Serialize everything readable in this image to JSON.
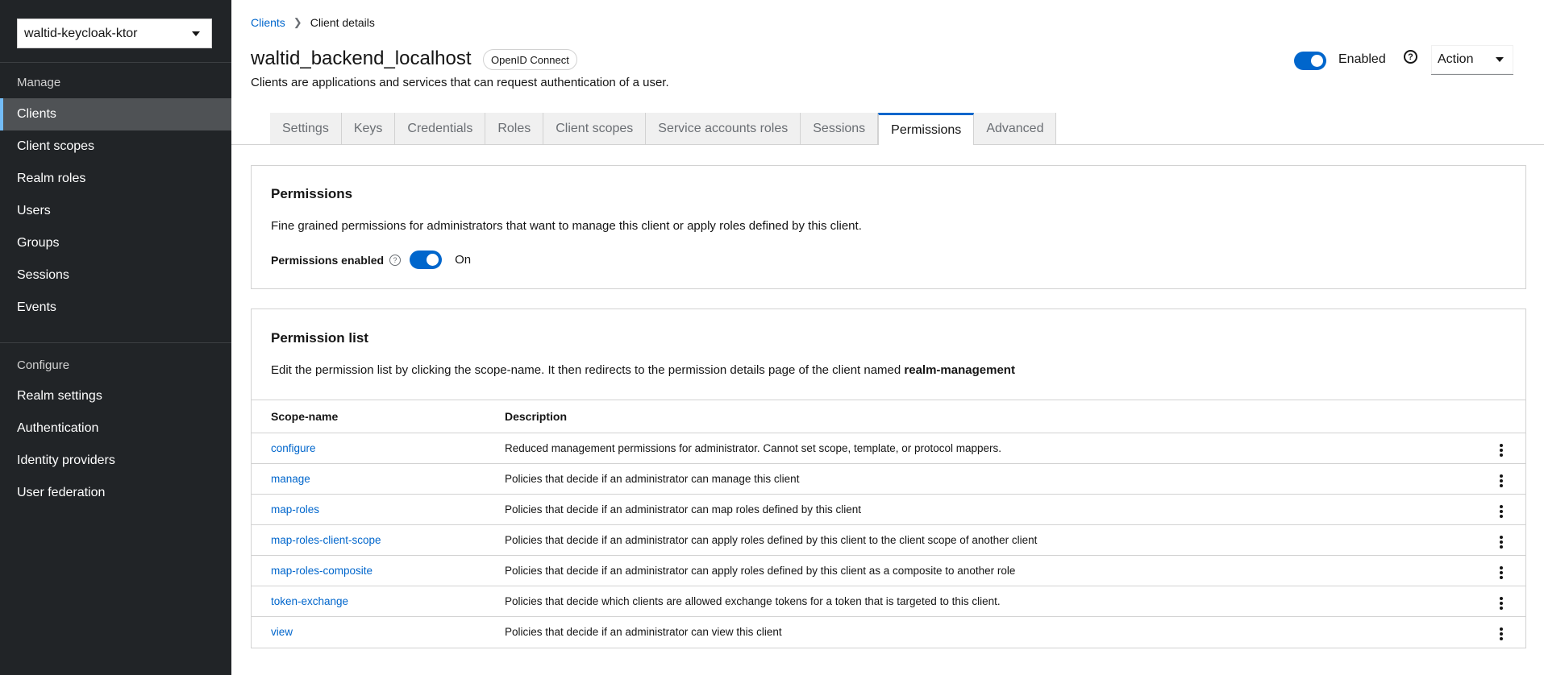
{
  "sidebar": {
    "realm": "waltid-keycloak-ktor",
    "manage_label": "Manage",
    "manage_items": [
      "Clients",
      "Client scopes",
      "Realm roles",
      "Users",
      "Groups",
      "Sessions",
      "Events"
    ],
    "configure_label": "Configure",
    "configure_items": [
      "Realm settings",
      "Authentication",
      "Identity providers",
      "User federation"
    ]
  },
  "breadcrumb": {
    "parent": "Clients",
    "current": "Client details"
  },
  "header": {
    "title": "waltid_backend_localhost",
    "badge": "OpenID Connect",
    "subtitle": "Clients are applications and services that can request authentication of a user.",
    "enabled_label": "Enabled",
    "enabled": true,
    "action_label": "Action"
  },
  "tabs": [
    "Settings",
    "Keys",
    "Credentials",
    "Roles",
    "Client scopes",
    "Service accounts roles",
    "Sessions",
    "Permissions",
    "Advanced"
  ],
  "active_tab": "Permissions",
  "permissions_card": {
    "title": "Permissions",
    "description": "Fine grained permissions for administrators that want to manage this client or apply roles defined by this client.",
    "toggle_label": "Permissions enabled",
    "toggle_state": "On"
  },
  "list_card": {
    "title": "Permission list",
    "description_prefix": "Edit the permission list by clicking the scope-name. It then redirects to the permission details page of the client named ",
    "description_client": "realm-management",
    "columns": [
      "Scope-name",
      "Description"
    ],
    "rows": [
      {
        "scope": "configure",
        "description": "Reduced management permissions for administrator. Cannot set scope, template, or protocol mappers."
      },
      {
        "scope": "manage",
        "description": "Policies that decide if an administrator can manage this client"
      },
      {
        "scope": "map-roles",
        "description": "Policies that decide if an administrator can map roles defined by this client"
      },
      {
        "scope": "map-roles-client-scope",
        "description": "Policies that decide if an administrator can apply roles defined by this client to the client scope of another client"
      },
      {
        "scope": "map-roles-composite",
        "description": "Policies that decide if an administrator can apply roles defined by this client as a composite to another role"
      },
      {
        "scope": "token-exchange",
        "description": "Policies that decide which clients are allowed exchange tokens for a token that is targeted to this client."
      },
      {
        "scope": "view",
        "description": "Policies that decide if an administrator can view this client"
      }
    ]
  },
  "colors": {
    "accent": "#0066cc",
    "sidebar_bg": "#212427",
    "sidebar_active": "#4f5255"
  }
}
